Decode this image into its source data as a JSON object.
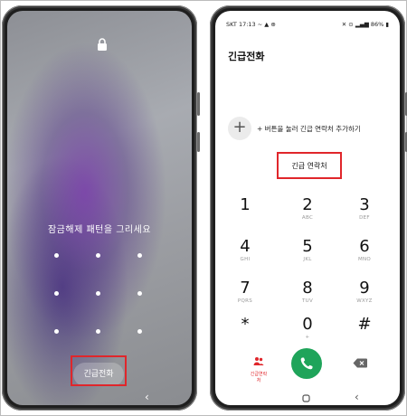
{
  "lock_screen": {
    "instruction": "잠금해제 패턴을 그리세요",
    "emergency_button": "긴급전화",
    "lock_icon": "lock-icon",
    "back_icon": "chevron-left-icon"
  },
  "dialer": {
    "status": {
      "carrier": "SKT",
      "time": "17:13",
      "battery": "86%"
    },
    "title": "긴급전화",
    "add_hint": "+ 버튼을 눌러 긴급 연락처 추가하기",
    "contacts_button": "긴급 연락처",
    "keys": [
      {
        "num": "1",
        "letters": ""
      },
      {
        "num": "2",
        "letters": "ABC"
      },
      {
        "num": "3",
        "letters": "DEF"
      },
      {
        "num": "4",
        "letters": "GHI"
      },
      {
        "num": "5",
        "letters": "JKL"
      },
      {
        "num": "6",
        "letters": "MNO"
      },
      {
        "num": "7",
        "letters": "PQRS"
      },
      {
        "num": "8",
        "letters": "TUV"
      },
      {
        "num": "9",
        "letters": "WXYZ"
      },
      {
        "num": "*",
        "letters": ""
      },
      {
        "num": "0",
        "letters": "+"
      },
      {
        "num": "#",
        "letters": ""
      }
    ],
    "emergency_contacts_label": "긴급연락처",
    "call_icon": "phone-icon",
    "backspace_icon": "backspace-icon"
  },
  "colors": {
    "highlight": "#e0262b",
    "call_green": "#1fa45a"
  }
}
